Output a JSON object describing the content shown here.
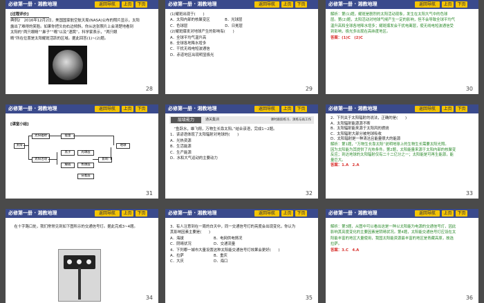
{
  "header": {
    "title": "必修第一册 · 湘教地理",
    "nav": "返回导航",
    "prev": "上页",
    "next": "下页"
  },
  "slides": [
    {
      "page": "28",
      "tag": "[过程评价]",
      "lines": [
        "典例2　2016年12月2日，美国国家航空航天局(NASA)公布的照片显示，太阳",
        "露出了难得的笑脸。如果你把头向右边倾斜，你从这张照片上会清楚地看到",
        "太阳的“两只眼睛”“鼻子”“嘴”以及“酒窝”。科学家表示，“两只眼",
        "睛”所在位置是太阳耀斑活跃的区域。据此回答(1)~(2)题。"
      ]
    },
    {
      "page": "29",
      "lines": [
        "(1)耀斑出现于(　　)",
        "A．太阳内部的核聚变区　　　　B．光球层",
        "C．色球层　　　　　　　　　　D．日冕层",
        "(2)耀斑爆发对地球产生的影响有(　　)",
        "A．全球平均气温升高",
        "B．全球各地降水增多",
        "C．干扰无线电短波通信",
        "D．赤道地区出现明显极光"
      ]
    },
    {
      "page": "30",
      "lines": [
        "解析：第(1)题，耀斑是剧烈的太阳活动现象，发生在太阳大气中的色球",
        "层。第(2)题，太阳活动对地球气候产生一定的影响，但不会导致全球平均气",
        "温升高和全球各地降水增多；耀斑爆发会干扰电离层，使无线电短波通信受",
        "到影响，极光多出现在高纬度地区。"
      ],
      "answer": "答案：(1)C　(2)C"
    },
    {
      "page": "31",
      "tag": "[课堂小结]",
      "diagram": [
        "太阳",
        "太阳辐射",
        "太阳活动",
        "黑子",
        "耀斑",
        "光球层",
        "色球层",
        "地球",
        "日冕层",
        "能量",
        "影响"
      ]
    },
    {
      "page": "32",
      "bar_tag": "层级能力",
      "bar_text": "通关集训",
      "bar_right": "课时跟踪练习、演练与再工作",
      "lines": [
        "　“鱼跃水，雄飞翔，万物生长靠太阳。”结合该语，完成1~2题。",
        "1．该谚语体现了太阳辐射对地球的(　　)",
        "A．光热资源",
        "B．生活能源",
        "C．生产能源",
        "D．水和大气运动的主要动力"
      ]
    },
    {
      "page": "33",
      "lines": [
        "2．下列关于太阳辐射的说法，正确的是(　　)",
        "A．太阳辐射能源源不断",
        "B．太阳辐射能来源于太阳风的燃烧",
        "C．太阳辐射大部分被地球吸收",
        "D．太阳辐射是一种清洁且能量很大的能源"
      ],
      "explain": [
        "解析：第1题，“万物生长靠太阳”说明地球上的生物生长需要太阳光照。",
        "因为太阳能为其提供了光热条件。第2题，太阳能量来源于太阳内部的核聚变",
        "反应；到达地球的太阳辐射仅有二十二亿分之一；太阳能是可再生能源，能",
        "量巨大。"
      ],
      "answer": "答案：1.A　2.A"
    },
    {
      "page": "34",
      "lines": [
        "　在十字路口处，我们常常见到如下图所示的交通信号灯。据此完成3~4题。"
      ]
    },
    {
      "page": "35",
      "lines": [
        "3．有人注意到在一周的白天中，同一交通信号灯的亮度会出现变化，你认为",
        "其影响因素主要是(　　)",
        "A．海拔　　　　　　　　B．电网供电情况",
        "C．阴晴状况　　　　　　D．交通流量",
        "4．下列哪一城市大量设置这种太阳能交通信号灯效果会更好(　　)",
        "A．拉萨　　　　　　　　B．重庆",
        "C．大庆　　　　　　　　D．海口"
      ]
    },
    {
      "page": "36",
      "lines": [
        "解析：第3题，从图中可以看出这是一种以太阳能为电源的交通信号灯，因此",
        "影响其亮度变化的主要因素是阴晴状况。第4题，太阳能交通信号灯应设在太",
        "阳能丰富的地区大量使用，我国太阳能资源最丰富的地区是青藏高原，故选",
        "拉萨。"
      ],
      "answer": "答案：3.C　4.A"
    }
  ]
}
